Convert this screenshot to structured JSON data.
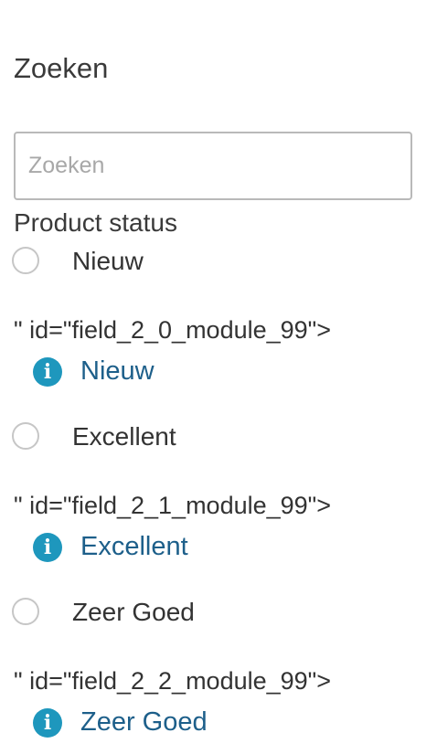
{
  "search": {
    "heading": "Zoeken",
    "placeholder": "Zoeken",
    "value": ""
  },
  "filter": {
    "label": "Product status",
    "options": [
      {
        "label": "Nieuw",
        "stray_text": "\" id=\"field_2_0_module_99\">",
        "info_label": "Nieuw",
        "selected": false
      },
      {
        "label": "Excellent",
        "stray_text": "\" id=\"field_2_1_module_99\">",
        "info_label": "Excellent",
        "selected": false
      },
      {
        "label": "Zeer Goed",
        "stray_text": "\" id=\"field_2_2_module_99\">",
        "info_label": "Zeer Goed",
        "selected": false
      }
    ]
  },
  "icons": {
    "info": "info-icon",
    "radio": "radio-unchecked"
  },
  "colors": {
    "info_icon": "#1e97bd",
    "link": "#1d5f8a",
    "border": "#b9b9b9"
  }
}
